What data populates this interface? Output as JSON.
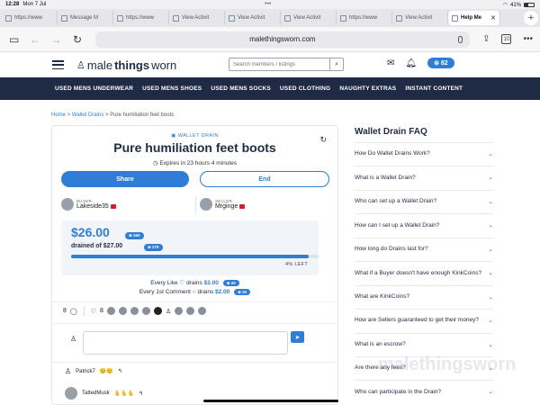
{
  "status": {
    "time": "12:28",
    "date": "Mon 7 Jul",
    "battery": "41%"
  },
  "tabs": [
    {
      "label": "https://www"
    },
    {
      "label": "Message M"
    },
    {
      "label": "https://www"
    },
    {
      "label": "View Activit"
    },
    {
      "label": "View Activit"
    },
    {
      "label": "View Activit"
    },
    {
      "label": "https://www"
    },
    {
      "label": "View Activit"
    },
    {
      "label": "Help Me"
    }
  ],
  "browser": {
    "url": "malethingsworn.com",
    "tab_count": "10"
  },
  "site": {
    "logo_prefix": "male",
    "logo_mid": "things",
    "logo_suffix": "worn",
    "search_placeholder": "Search members / listings",
    "coins": "82"
  },
  "nav": [
    "USED MENS UNDERWEAR",
    "USED MENS SHOES",
    "USED MENS SOCKS",
    "USED CLOTHING",
    "NAUGHTY EXTRAS",
    "INSTANT CONTENT"
  ],
  "breadcrumb": {
    "home": "Home",
    "sep": ">",
    "section": "Wallet Drains",
    "current": "Pure humiliation feet boots"
  },
  "drain": {
    "badge": "WALLET DRAIN",
    "title": "Pure humiliation feet boots",
    "expires": "Expires in 23 hours 4 minutes",
    "share_label": "Share",
    "end_label": "End",
    "buyer_role": "BUYER",
    "buyer_name": "Lakeside35",
    "seller_role": "SELLER",
    "seller_name": "Mrginge",
    "amount": "$26.00",
    "amount_coins": "260",
    "drained_text": "drained of $27.00",
    "drained_coins": "270",
    "progress_fraction": 0.96,
    "pct_label": "4% LEFT",
    "like_rate_pre": "Every Like",
    "like_rate_mid": "drains",
    "like_rate_amt": "$2.00",
    "like_rate_coins": "20",
    "comment_rate_pre": "Every 1st Comment",
    "comment_rate_mid": "drains",
    "comment_rate_amt": "$2.00",
    "comment_rate_coins": "20",
    "comment_count": "8",
    "like_count": "8"
  },
  "comments": [
    {
      "user": "Patrick7",
      "extra": "😊😊"
    },
    {
      "user": "TattedMusk",
      "extra": "🫰🫰🫰"
    }
  ],
  "faq": {
    "title": "Wallet Drain FAQ",
    "items": [
      "How Do Wallet Drains Work?",
      "What is a Wallet Drain?",
      "Who can set up a Wallet Drain?",
      "How can I set up a Wallet Drain?",
      "How long do Drains last for?",
      "What if a Buyer doesn't have enough KinkCoins?",
      "What are KinkCoins?",
      "How are Sellers guaranteed to get their money?",
      "What is an escrow?",
      "Are there any fees?",
      "Who can participate in the Drain?"
    ]
  },
  "watermark": "malethingsworn",
  "colors": {
    "accent": "#2f7dd6",
    "navy": "#1f2a44",
    "flag": "#cc2233"
  }
}
